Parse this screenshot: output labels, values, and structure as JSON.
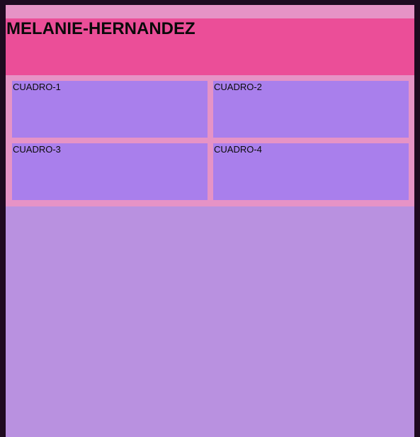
{
  "header": {
    "title": "MELANIE-HERNANDEZ"
  },
  "boxes": [
    {
      "label": "CUADRO-1"
    },
    {
      "label": "CUADRO-2"
    },
    {
      "label": "CUADRO-3"
    },
    {
      "label": "CUADRO-4"
    }
  ],
  "colors": {
    "frame": "#1f0a20",
    "page_background": "#b991e0",
    "top_strip": "#e693c6",
    "header_background": "#eb4e98",
    "grid_background": "#e693c6",
    "box_background": "#a97fec",
    "text": "#0a0a0a"
  }
}
